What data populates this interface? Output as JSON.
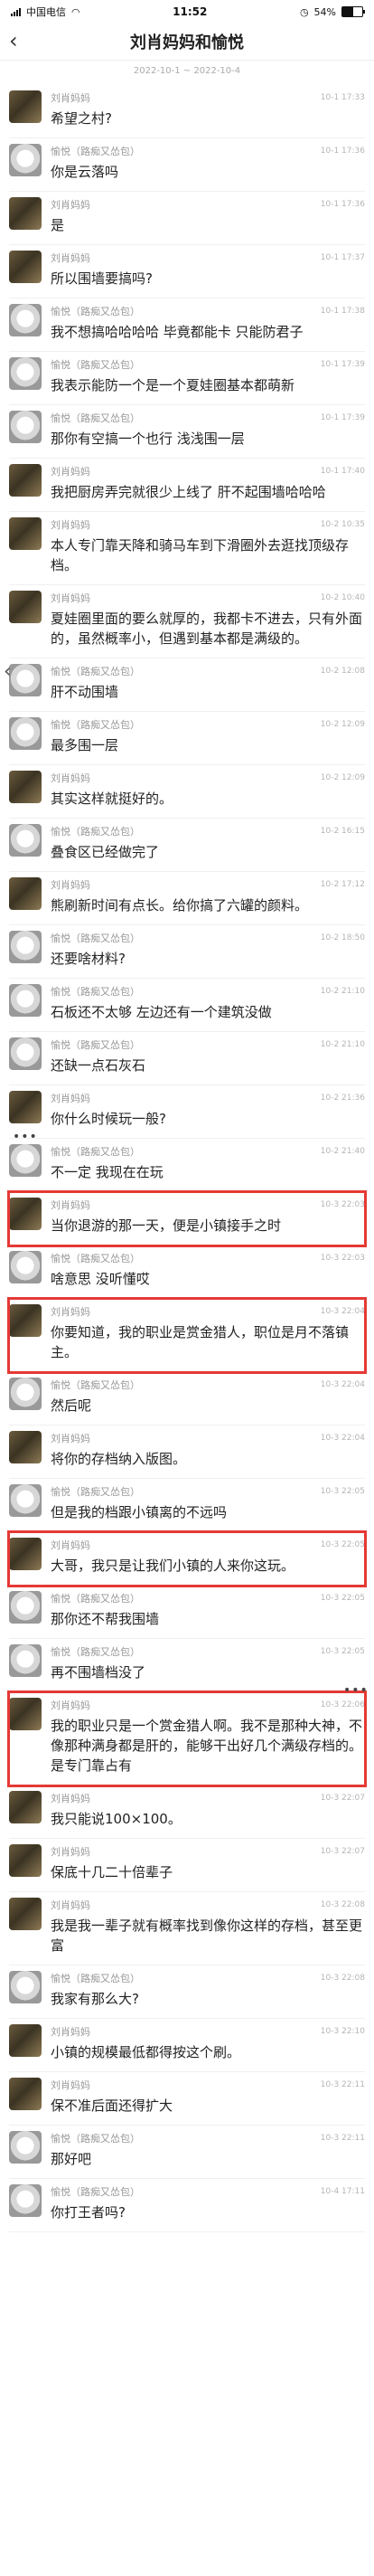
{
  "status": {
    "carrier": "中国电信",
    "time": "11:52",
    "battery": "54%",
    "battery_level": 0.54
  },
  "header": {
    "title": "刘肖妈妈和愉悦",
    "date_range": "2022-10-1 ~ 2022-10-4"
  },
  "messages": [
    {
      "sender": "刘肖妈妈",
      "time": "10-1 17:33",
      "text": "希望之村?",
      "avatar": "liu"
    },
    {
      "sender": "愉悦（路痴又怂包）",
      "time": "10-1 17:36",
      "text": "你是云落吗",
      "avatar": "yu"
    },
    {
      "sender": "刘肖妈妈",
      "time": "10-1 17:36",
      "text": "是",
      "avatar": "liu"
    },
    {
      "sender": "刘肖妈妈",
      "time": "10-1 17:37",
      "text": "所以围墙要搞吗?",
      "avatar": "liu"
    },
    {
      "sender": "愉悦（路痴又怂包）",
      "time": "10-1 17:38",
      "text": "我不想搞哈哈哈哈 毕竟都能卡 只能防君子",
      "avatar": "yu"
    },
    {
      "sender": "愉悦（路痴又怂包）",
      "time": "10-1 17:39",
      "text": "我表示能防一个是一个夏娃圈基本都萌新",
      "avatar": "yu"
    },
    {
      "sender": "愉悦（路痴又怂包）",
      "time": "10-1 17:39",
      "text": "那你有空搞一个也行 浅浅围一层",
      "avatar": "yu"
    },
    {
      "sender": "刘肖妈妈",
      "time": "10-1 17:40",
      "text": "我把厨房弄完就很少上线了 肝不起围墙哈哈哈",
      "avatar": "liu"
    },
    {
      "sender": "刘肖妈妈",
      "time": "10-2 10:35",
      "text": "本人专门靠天降和骑马车到下滑圈外去逛找顶级存档。",
      "avatar": "liu"
    },
    {
      "sender": "刘肖妈妈",
      "time": "10-2 10:40",
      "text": "夏娃圈里面的要么就厚的，我都卡不进去，只有外面的，虽然概率小，但遇到基本都是满级的。",
      "avatar": "liu"
    },
    {
      "sender": "愉悦（路痴又怂包）",
      "time": "10-2 12:08",
      "text": "肝不动围墙",
      "avatar": "yu"
    },
    {
      "sender": "愉悦（路痴又怂包）",
      "time": "10-2 12:09",
      "text": "最多围一层",
      "avatar": "yu"
    },
    {
      "sender": "刘肖妈妈",
      "time": "10-2 12:09",
      "text": "其实这样就挺好的。",
      "avatar": "liu"
    },
    {
      "sender": "愉悦（路痴又怂包）",
      "time": "10-2 16:15",
      "text": "叠食区已经做完了",
      "avatar": "yu"
    },
    {
      "sender": "刘肖妈妈",
      "time": "10-2 17:12",
      "text": "熊刷新时间有点长。给你搞了六罐的颜料。",
      "avatar": "liu"
    },
    {
      "sender": "愉悦（路痴又怂包）",
      "time": "10-2 18:50",
      "text": "还要啥材料?",
      "avatar": "yu"
    },
    {
      "sender": "愉悦（路痴又怂包）",
      "time": "10-2 21:10",
      "text": "石板还不太够 左边还有一个建筑没做",
      "avatar": "yu"
    },
    {
      "sender": "愉悦（路痴又怂包）",
      "time": "10-2 21:10",
      "text": "还缺一点石灰石",
      "avatar": "yu"
    },
    {
      "sender": "刘肖妈妈",
      "time": "10-2 21:36",
      "text": "你什么时候玩一般?",
      "avatar": "liu"
    },
    {
      "sender": "愉悦（路痴又怂包）",
      "time": "10-2 21:40",
      "text": "不一定 我现在在玩",
      "avatar": "yu"
    },
    {
      "sender": "刘肖妈妈",
      "time": "10-3 22:03",
      "text": "当你退游的那一天，便是小镇接手之时",
      "avatar": "liu"
    },
    {
      "sender": "愉悦（路痴又怂包）",
      "time": "10-3 22:03",
      "text": "啥意思 没听懂哎",
      "avatar": "yu"
    },
    {
      "sender": "刘肖妈妈",
      "time": "10-3 22:04",
      "text": "你要知道，我的职业是赏金猎人，职位是月不落镇主。",
      "avatar": "liu"
    },
    {
      "sender": "愉悦（路痴又怂包）",
      "time": "10-3 22:04",
      "text": "然后呢",
      "avatar": "yu"
    },
    {
      "sender": "刘肖妈妈",
      "time": "10-3 22:04",
      "text": "将你的存档纳入版图。",
      "avatar": "liu"
    },
    {
      "sender": "愉悦（路痴又怂包）",
      "time": "10-3 22:05",
      "text": "但是我的档跟小镇离的不远吗",
      "avatar": "yu"
    },
    {
      "sender": "刘肖妈妈",
      "time": "10-3 22:05",
      "text": "大哥，我只是让我们小镇的人来你这玩。",
      "avatar": "liu"
    },
    {
      "sender": "愉悦（路痴又怂包）",
      "time": "10-3 22:05",
      "text": "那你还不帮我围墙",
      "avatar": "yu"
    },
    {
      "sender": "愉悦（路痴又怂包）",
      "time": "10-3 22:05",
      "text": "再不围墙档没了",
      "avatar": "yu"
    },
    {
      "sender": "刘肖妈妈",
      "time": "10-3 22:06",
      "text": "我的职业只是一个赏金猎人啊。我不是那种大神，不像那种满身都是肝的，能够干出好几个满级存档的。是专门靠占有",
      "avatar": "liu"
    },
    {
      "sender": "刘肖妈妈",
      "time": "10-3 22:07",
      "text": "我只能说100×100。",
      "avatar": "liu"
    },
    {
      "sender": "刘肖妈妈",
      "time": "10-3 22:07",
      "text": "保底十几二十倍辈子",
      "avatar": "liu"
    },
    {
      "sender": "刘肖妈妈",
      "time": "10-3 22:08",
      "text": "我是我一辈子就有概率找到像你这样的存档，甚至更富",
      "avatar": "liu"
    },
    {
      "sender": "愉悦（路痴又怂包）",
      "time": "10-3 22:08",
      "text": "我家有那么大?",
      "avatar": "yu"
    },
    {
      "sender": "刘肖妈妈",
      "time": "10-3 22:10",
      "text": "小镇的规模最低都得按这个刷。",
      "avatar": "liu"
    },
    {
      "sender": "刘肖妈妈",
      "time": "10-3 22:11",
      "text": "保不准后面还得扩大",
      "avatar": "liu"
    },
    {
      "sender": "愉悦（路痴又怂包）",
      "time": "10-3 22:11",
      "text": "那好吧",
      "avatar": "yu"
    },
    {
      "sender": "愉悦（路痴又怂包）",
      "time": "10-4 17:11",
      "text": "你打王者吗?",
      "avatar": "yu"
    }
  ]
}
